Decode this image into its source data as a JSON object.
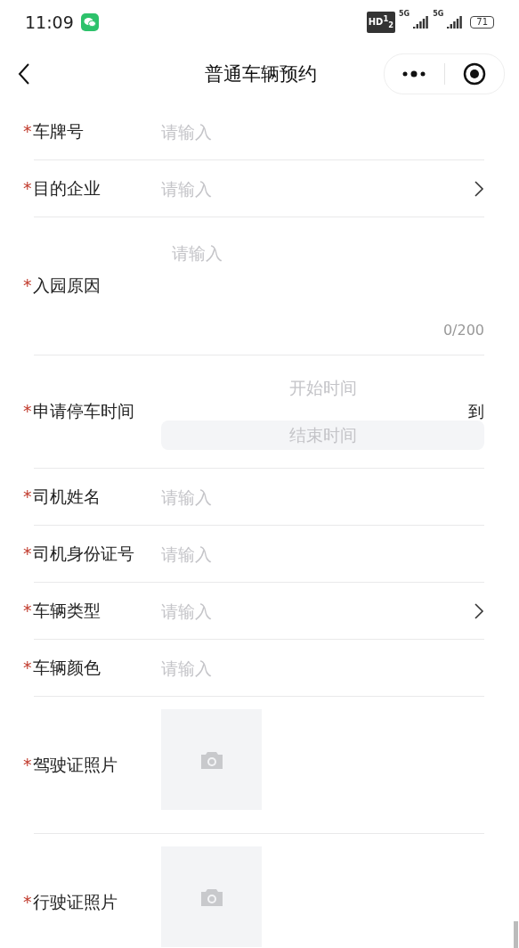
{
  "status_bar": {
    "time": "11:09",
    "hd": "HD$^{1}$$_{2}$",
    "networks": [
      "5G",
      "5G"
    ],
    "battery": "71"
  },
  "nav": {
    "title": "普通车辆预约"
  },
  "fields": [
    {
      "kind": "input",
      "mark": "*",
      "label": "车牌号",
      "placeholder": "请输入"
    },
    {
      "kind": "select",
      "mark": "*",
      "label": "目的企业",
      "placeholder": "请输入"
    },
    {
      "kind": "textarea",
      "mark": "*",
      "label": "入园原因",
      "placeholder": "请输入",
      "counter": "0/200"
    },
    {
      "kind": "daterange",
      "mark": "*",
      "label": "申请停车时间",
      "start": "开始时间",
      "separator": "到",
      "end": "结束时间"
    },
    {
      "kind": "input",
      "mark": "*",
      "label": "司机姓名",
      "placeholder": "请输入"
    },
    {
      "kind": "input",
      "mark": "*",
      "label": "司机身份证号",
      "placeholder": "请输入"
    },
    {
      "kind": "select",
      "mark": "*",
      "label": "车辆类型",
      "placeholder": "请输入"
    },
    {
      "kind": "input",
      "mark": "*",
      "label": "车辆颜色",
      "placeholder": "请输入"
    },
    {
      "kind": "upload",
      "mark": "*",
      "label": "驾驶证照片"
    },
    {
      "kind": "upload",
      "mark": "*",
      "label": "行驶证照片"
    }
  ]
}
